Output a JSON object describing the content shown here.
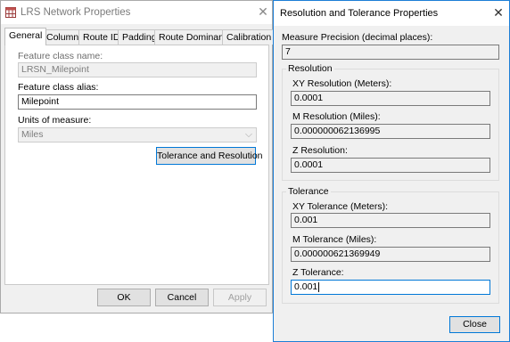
{
  "lrs_dialog": {
    "title": "LRS Network Properties",
    "tabs": [
      "General",
      "Columns",
      "Route ID",
      "Padding",
      "Route Dominance",
      "Calibration"
    ],
    "active_tab": "General",
    "feature_class_name_label": "Feature class name:",
    "feature_class_name_value": "LRSN_Milepoint",
    "feature_class_alias_label": "Feature class alias:",
    "feature_class_alias_value": "Milepoint",
    "units_label": "Units of measure:",
    "units_value": "Miles",
    "tolerance_button": "Tolerance and Resolution",
    "ok_button": "OK",
    "cancel_button": "Cancel",
    "apply_button": "Apply"
  },
  "rt_dialog": {
    "title": "Resolution and Tolerance Properties",
    "measure_precision_label": "Measure Precision (decimal places):",
    "measure_precision_value": "7",
    "resolution_group": {
      "title": "Resolution",
      "xy_label": "XY Resolution (Meters):",
      "xy_value": "0.0001",
      "m_label": "M Resolution (Miles):",
      "m_value": "0.000000062136995",
      "z_label": "Z Resolution:",
      "z_value": "0.0001"
    },
    "tolerance_group": {
      "title": "Tolerance",
      "xy_label": "XY Tolerance (Meters):",
      "xy_value": "0.001",
      "m_label": "M Tolerance (Miles):",
      "m_value": "0.000000621369949",
      "z_label": "Z Tolerance:",
      "z_value": "0.001"
    },
    "close_button": "Close"
  }
}
